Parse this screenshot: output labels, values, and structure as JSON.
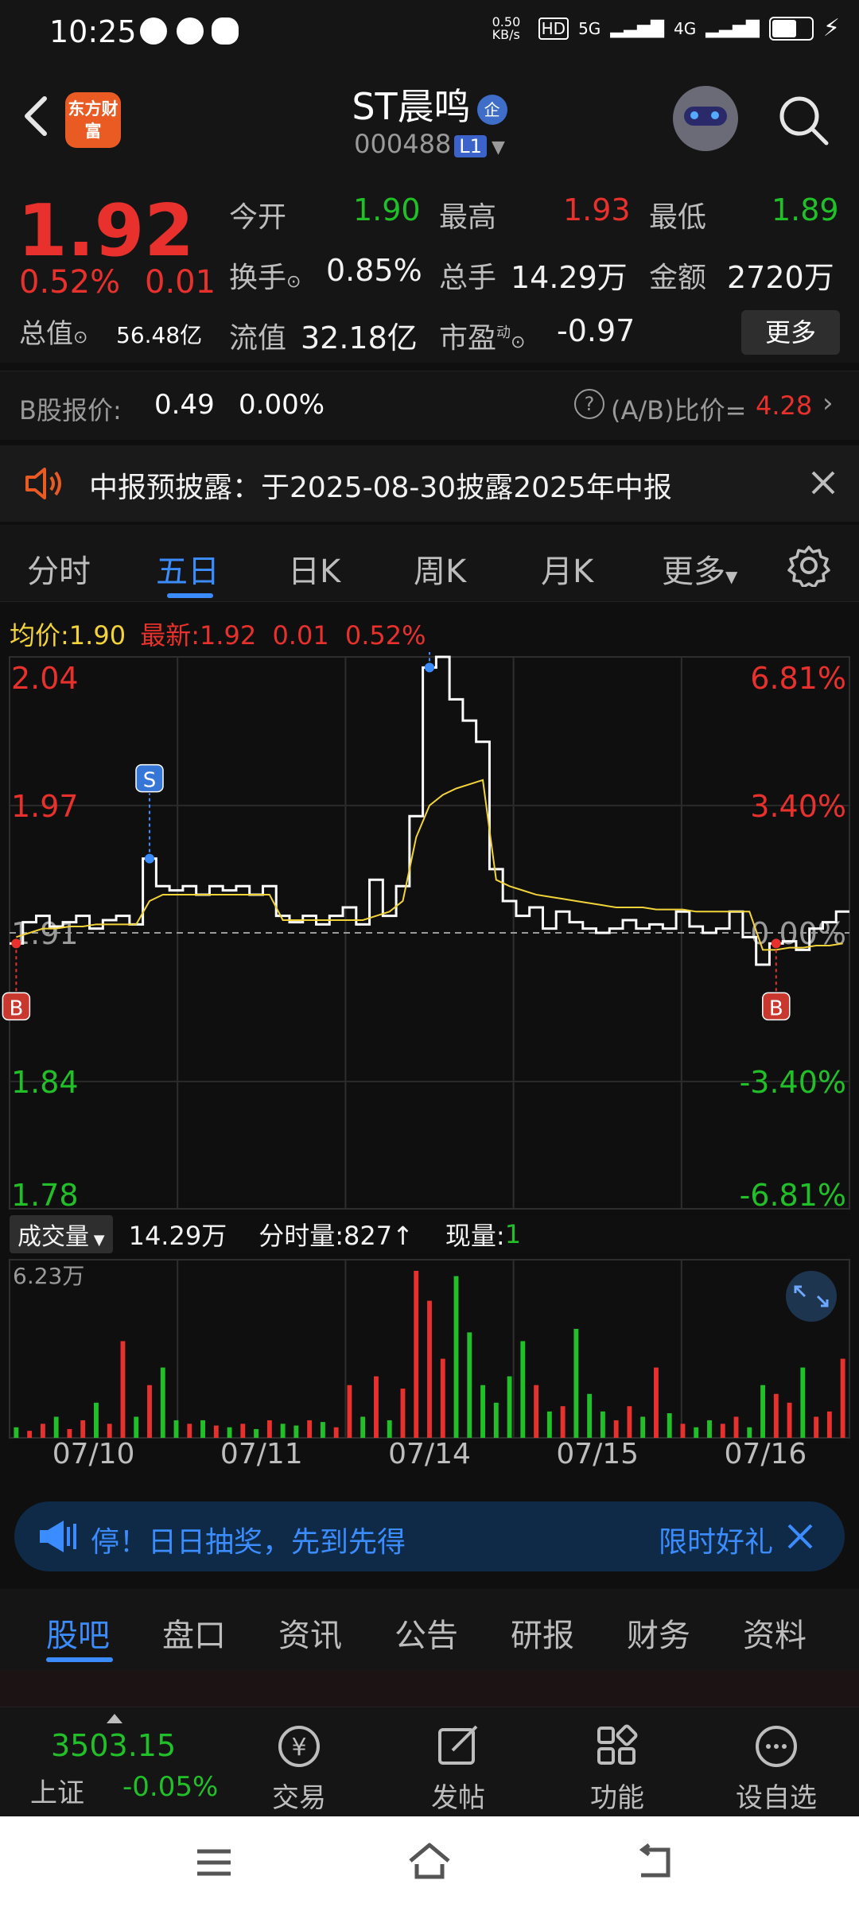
{
  "status_bar": {
    "time": "10:25",
    "net_speed": "0.50 KB/s",
    "signal_labels": [
      "HD",
      "5G",
      "4G"
    ]
  },
  "header": {
    "logo_text": "东方财富",
    "title": "ST晨鸣",
    "title_badge": "企",
    "code": "000488",
    "level": "L1"
  },
  "quote": {
    "price": "1.92",
    "change_pct": "0.52%",
    "change": "0.01",
    "open_label": "今开",
    "open": "1.90",
    "high_label": "最高",
    "high": "1.93",
    "low_label": "最低",
    "low": "1.89",
    "turnover_label": "换手",
    "turnover": "0.85%",
    "volume_label": "总手",
    "volume": "14.29万",
    "amount_label": "金额",
    "amount": "2720万",
    "total_value_label": "总值",
    "total_value": "56.48亿",
    "float_value_label": "流值",
    "float_value": "32.18亿",
    "pe_label": "市盈",
    "pe_sup": "动",
    "pe": "-0.97",
    "more_label": "更多"
  },
  "b_share": {
    "label": "B股报价:",
    "price": "0.49",
    "pct": "0.00%",
    "ratio_label": "(A/B)比价=",
    "ratio": "4.28"
  },
  "notice": {
    "text": "中报预披露：于2025-08-30披露2025年中报"
  },
  "chart_tabs": [
    "分时",
    "五日",
    "日K",
    "周K",
    "月K",
    "更多"
  ],
  "chart_tab_active": "五日",
  "legend": {
    "avg_label": "均价:",
    "avg": "1.90",
    "latest_label": "最新:",
    "latest": "1.92",
    "change": "0.01",
    "pct": "0.52%"
  },
  "chart_data": {
    "type": "line",
    "title": "",
    "x_labels": [
      "07/10",
      "07/11",
      "07/14",
      "07/15",
      "07/16"
    ],
    "price_ticks": [
      "2.04",
      "1.97",
      "1.91",
      "1.84",
      "1.78"
    ],
    "pct_ticks": [
      "6.81%",
      "3.40%",
      "0.00%",
      "-3.40%",
      "-6.81%"
    ],
    "ylim": [
      1.78,
      2.04
    ],
    "base": 1.91,
    "series": [
      {
        "values": [
          1.905,
          1.915,
          1.918,
          1.913,
          1.915,
          1.918,
          1.912,
          1.916,
          1.918,
          1.914,
          1.945,
          1.932,
          1.93,
          1.932,
          1.928,
          1.932,
          1.93,
          1.932,
          1.928,
          1.932,
          1.918,
          1.915,
          1.918,
          1.914,
          1.918,
          1.922,
          1.914,
          1.935,
          1.918,
          1.932,
          1.965,
          2.035,
          2.04,
          2.02,
          2.01,
          2.0,
          1.94,
          1.925,
          1.918,
          1.922,
          1.912,
          1.92,
          1.915,
          1.912,
          1.91,
          1.912,
          1.916,
          1.912,
          1.914,
          1.912,
          1.92,
          1.913,
          1.91,
          1.912,
          1.92,
          1.908,
          1.895,
          1.905,
          1.906,
          1.902,
          1.912,
          1.915,
          1.92
        ]
      },
      {
        "values": [
          1.908,
          1.91,
          1.912,
          1.912,
          1.913,
          1.913,
          1.914,
          1.914,
          1.914,
          1.914,
          1.925,
          1.928,
          1.928,
          1.928,
          1.928,
          1.928,
          1.928,
          1.928,
          1.928,
          1.928,
          1.916,
          1.916,
          1.916,
          1.916,
          1.916,
          1.916,
          1.916,
          1.918,
          1.92,
          1.925,
          1.955,
          1.97,
          1.975,
          1.978,
          1.98,
          1.982,
          1.935,
          1.932,
          1.93,
          1.928,
          1.927,
          1.926,
          1.925,
          1.924,
          1.923,
          1.922,
          1.922,
          1.922,
          1.921,
          1.921,
          1.921,
          1.92,
          1.92,
          1.92,
          1.92,
          1.92,
          1.902,
          1.902,
          1.903,
          1.903,
          1.904,
          1.904,
          1.905
        ]
      }
    ],
    "markers": [
      {
        "label": "B",
        "index": 0
      },
      {
        "label": "S",
        "index": 10
      },
      {
        "label": "S",
        "index": 31
      },
      {
        "label": "B",
        "index": 57
      }
    ],
    "volume_max_label": "6.23万",
    "volume": [
      0.06,
      0.04,
      0.08,
      0.12,
      0.05,
      0.1,
      0.2,
      0.08,
      0.55,
      0.12,
      0.3,
      0.4,
      0.1,
      0.08,
      0.1,
      0.07,
      0.06,
      0.08,
      0.05,
      0.1,
      0.08,
      0.07,
      0.1,
      0.09,
      0.06,
      0.3,
      0.12,
      0.35,
      0.1,
      0.28,
      0.95,
      0.78,
      0.45,
      0.92,
      0.6,
      0.3,
      0.2,
      0.35,
      0.55,
      0.3,
      0.15,
      0.18,
      0.62,
      0.25,
      0.15,
      0.1,
      0.18,
      0.12,
      0.4,
      0.14,
      0.08,
      0.06,
      0.1,
      0.08,
      0.12,
      0.06,
      0.3,
      0.25,
      0.2,
      0.4,
      0.12,
      0.15,
      0.45
    ]
  },
  "volume_bar": {
    "selector_label": "成交量",
    "total": "14.29万",
    "tick_label": "分时量:827↑",
    "now_label": "现量:",
    "now_value": "1"
  },
  "ad_banner": {
    "text": "停！日日抽奖，先到先得",
    "right_text": "限时好礼"
  },
  "bottom_tabs": [
    "股吧",
    "盘口",
    "资讯",
    "公告",
    "研报",
    "财务",
    "资料"
  ],
  "bottom_tab_active": "股吧",
  "toolbar": {
    "index_value": "3503.15",
    "index_name": "上证",
    "index_pct": "-0.05%",
    "items": [
      "交易",
      "发帖",
      "功能",
      "设自选"
    ]
  }
}
